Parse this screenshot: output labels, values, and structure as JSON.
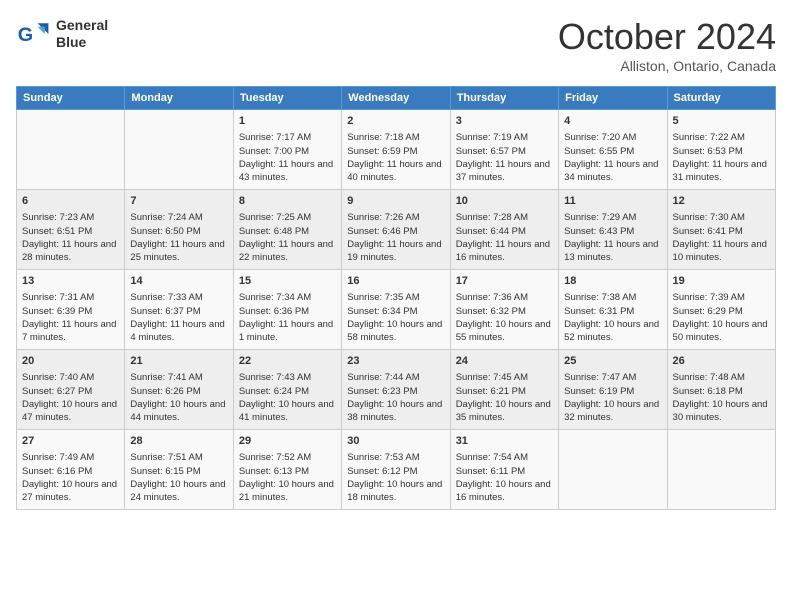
{
  "logo": {
    "line1": "General",
    "line2": "Blue"
  },
  "title": "October 2024",
  "location": "Alliston, Ontario, Canada",
  "days_of_week": [
    "Sunday",
    "Monday",
    "Tuesday",
    "Wednesday",
    "Thursday",
    "Friday",
    "Saturday"
  ],
  "weeks": [
    [
      {
        "day": "",
        "content": ""
      },
      {
        "day": "",
        "content": ""
      },
      {
        "day": "1",
        "content": "Sunrise: 7:17 AM\nSunset: 7:00 PM\nDaylight: 11 hours and 43 minutes."
      },
      {
        "day": "2",
        "content": "Sunrise: 7:18 AM\nSunset: 6:59 PM\nDaylight: 11 hours and 40 minutes."
      },
      {
        "day": "3",
        "content": "Sunrise: 7:19 AM\nSunset: 6:57 PM\nDaylight: 11 hours and 37 minutes."
      },
      {
        "day": "4",
        "content": "Sunrise: 7:20 AM\nSunset: 6:55 PM\nDaylight: 11 hours and 34 minutes."
      },
      {
        "day": "5",
        "content": "Sunrise: 7:22 AM\nSunset: 6:53 PM\nDaylight: 11 hours and 31 minutes."
      }
    ],
    [
      {
        "day": "6",
        "content": "Sunrise: 7:23 AM\nSunset: 6:51 PM\nDaylight: 11 hours and 28 minutes."
      },
      {
        "day": "7",
        "content": "Sunrise: 7:24 AM\nSunset: 6:50 PM\nDaylight: 11 hours and 25 minutes."
      },
      {
        "day": "8",
        "content": "Sunrise: 7:25 AM\nSunset: 6:48 PM\nDaylight: 11 hours and 22 minutes."
      },
      {
        "day": "9",
        "content": "Sunrise: 7:26 AM\nSunset: 6:46 PM\nDaylight: 11 hours and 19 minutes."
      },
      {
        "day": "10",
        "content": "Sunrise: 7:28 AM\nSunset: 6:44 PM\nDaylight: 11 hours and 16 minutes."
      },
      {
        "day": "11",
        "content": "Sunrise: 7:29 AM\nSunset: 6:43 PM\nDaylight: 11 hours and 13 minutes."
      },
      {
        "day": "12",
        "content": "Sunrise: 7:30 AM\nSunset: 6:41 PM\nDaylight: 11 hours and 10 minutes."
      }
    ],
    [
      {
        "day": "13",
        "content": "Sunrise: 7:31 AM\nSunset: 6:39 PM\nDaylight: 11 hours and 7 minutes."
      },
      {
        "day": "14",
        "content": "Sunrise: 7:33 AM\nSunset: 6:37 PM\nDaylight: 11 hours and 4 minutes."
      },
      {
        "day": "15",
        "content": "Sunrise: 7:34 AM\nSunset: 6:36 PM\nDaylight: 11 hours and 1 minute."
      },
      {
        "day": "16",
        "content": "Sunrise: 7:35 AM\nSunset: 6:34 PM\nDaylight: 10 hours and 58 minutes."
      },
      {
        "day": "17",
        "content": "Sunrise: 7:36 AM\nSunset: 6:32 PM\nDaylight: 10 hours and 55 minutes."
      },
      {
        "day": "18",
        "content": "Sunrise: 7:38 AM\nSunset: 6:31 PM\nDaylight: 10 hours and 52 minutes."
      },
      {
        "day": "19",
        "content": "Sunrise: 7:39 AM\nSunset: 6:29 PM\nDaylight: 10 hours and 50 minutes."
      }
    ],
    [
      {
        "day": "20",
        "content": "Sunrise: 7:40 AM\nSunset: 6:27 PM\nDaylight: 10 hours and 47 minutes."
      },
      {
        "day": "21",
        "content": "Sunrise: 7:41 AM\nSunset: 6:26 PM\nDaylight: 10 hours and 44 minutes."
      },
      {
        "day": "22",
        "content": "Sunrise: 7:43 AM\nSunset: 6:24 PM\nDaylight: 10 hours and 41 minutes."
      },
      {
        "day": "23",
        "content": "Sunrise: 7:44 AM\nSunset: 6:23 PM\nDaylight: 10 hours and 38 minutes."
      },
      {
        "day": "24",
        "content": "Sunrise: 7:45 AM\nSunset: 6:21 PM\nDaylight: 10 hours and 35 minutes."
      },
      {
        "day": "25",
        "content": "Sunrise: 7:47 AM\nSunset: 6:19 PM\nDaylight: 10 hours and 32 minutes."
      },
      {
        "day": "26",
        "content": "Sunrise: 7:48 AM\nSunset: 6:18 PM\nDaylight: 10 hours and 30 minutes."
      }
    ],
    [
      {
        "day": "27",
        "content": "Sunrise: 7:49 AM\nSunset: 6:16 PM\nDaylight: 10 hours and 27 minutes."
      },
      {
        "day": "28",
        "content": "Sunrise: 7:51 AM\nSunset: 6:15 PM\nDaylight: 10 hours and 24 minutes."
      },
      {
        "day": "29",
        "content": "Sunrise: 7:52 AM\nSunset: 6:13 PM\nDaylight: 10 hours and 21 minutes."
      },
      {
        "day": "30",
        "content": "Sunrise: 7:53 AM\nSunset: 6:12 PM\nDaylight: 10 hours and 18 minutes."
      },
      {
        "day": "31",
        "content": "Sunrise: 7:54 AM\nSunset: 6:11 PM\nDaylight: 10 hours and 16 minutes."
      },
      {
        "day": "",
        "content": ""
      },
      {
        "day": "",
        "content": ""
      }
    ]
  ]
}
